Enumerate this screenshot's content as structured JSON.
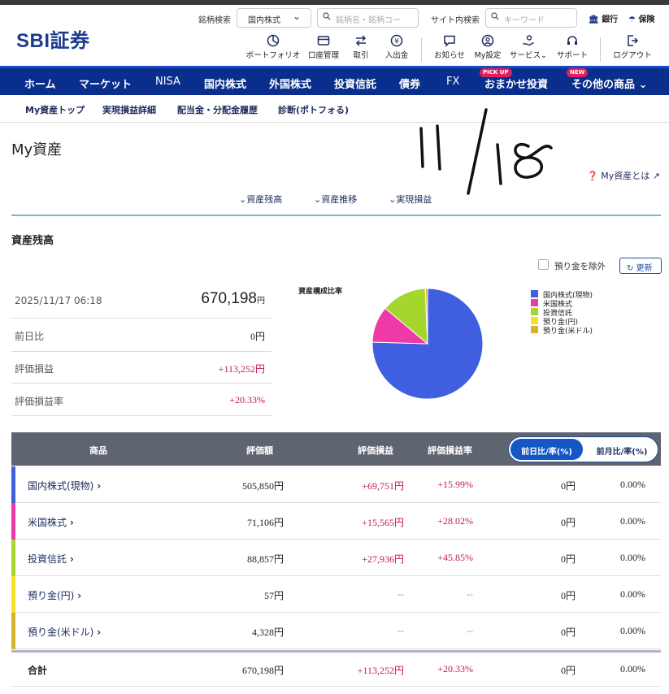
{
  "header": {
    "logo": "SBI証券",
    "brand_search_label": "銘柄検索",
    "market_select": "国内株式",
    "brand_search_placeholder": "銘柄名・銘柄コー",
    "site_search_label": "サイト内検索",
    "site_search_placeholder": "キーワード",
    "bank_link": "銀行",
    "insurance_link": "保険",
    "icons": [
      "ポートフォリオ",
      "口座管理",
      "取引",
      "入出金",
      "お知らせ",
      "My設定",
      "サービス",
      "サポート",
      "ログアウト"
    ]
  },
  "nav": {
    "items": [
      "ホーム",
      "マーケット",
      "NISA",
      "国内株式",
      "外国株式",
      "投資信託",
      "債券",
      "FX",
      "おまかせ投資",
      "その他の商品"
    ],
    "badge_pickup": "PICK UP",
    "badge_new": "NEW"
  },
  "subnav": [
    "My資産トップ",
    "実現損益詳細",
    "配当金・分配金履歴",
    "診断(ポトフォる)"
  ],
  "page": {
    "title": "My資産",
    "about_link": "My資産とは",
    "anchors": [
      "資産残高",
      "資産推移",
      "実現損益"
    ],
    "section_title": "資産残高",
    "exclude_deposit_label": "預り金を除外",
    "refresh_label": "更新"
  },
  "summary": {
    "datetime": "2025/11/17 06:18",
    "total_value": "670,198",
    "yen": "円",
    "rows": [
      {
        "label": "前日比",
        "value": "0円"
      },
      {
        "label": "評価損益",
        "value": "+113,252円"
      },
      {
        "label": "評価損益率",
        "value": "+20.33%"
      }
    ]
  },
  "chart_data": {
    "type": "pie",
    "title": "資産構成比率",
    "categories": [
      "国内株式(現物)",
      "米国株式",
      "投資信託",
      "預り金(円)",
      "預り金(米ドル)"
    ],
    "values": [
      505850,
      71106,
      88857,
      57,
      4328
    ],
    "colors": [
      "#3f5fe0",
      "#ee3aa7",
      "#a4d62c",
      "#f3e12a",
      "#d6b52a"
    ],
    "legend": "right"
  },
  "table": {
    "headers": [
      "商品",
      "評価額",
      "評価損益",
      "評価損益率"
    ],
    "toggle_on": "前日比/率(%)",
    "toggle_off": "前月比/率(%)",
    "rows": [
      {
        "name": "国内株式(現物)",
        "value": "505,850円",
        "pl": "+69,751円",
        "rate": "+15.99%",
        "diff": "0円",
        "diff_rate": "0.00%",
        "color": "#3f5fe0"
      },
      {
        "name": "米国株式",
        "value": "71,106円",
        "pl": "+15,565円",
        "rate": "+28.02%",
        "diff": "0円",
        "diff_rate": "0.00%",
        "color": "#ee3aa7"
      },
      {
        "name": "投資信託",
        "value": "88,857円",
        "pl": "+27,936円",
        "rate": "+45.85%",
        "diff": "0円",
        "diff_rate": "0.00%",
        "color": "#a4d62c"
      },
      {
        "name": "預り金(円)",
        "value": "57円",
        "pl": "--",
        "rate": "--",
        "diff": "0円",
        "diff_rate": "0.00%",
        "color": "#f3e12a"
      },
      {
        "name": "預り金(米ドル)",
        "value": "4,328円",
        "pl": "--",
        "rate": "--",
        "diff": "0円",
        "diff_rate": "0.00%",
        "color": "#d6b52a"
      }
    ],
    "total": {
      "name": "合計",
      "value": "670,198円",
      "pl": "+113,252円",
      "rate": "+20.33%",
      "diff": "0円",
      "diff_rate": "0.00%"
    }
  },
  "annotation": "11/18"
}
